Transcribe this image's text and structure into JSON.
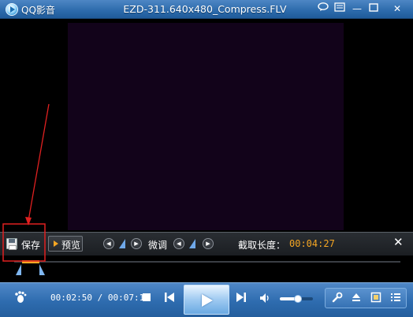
{
  "titlebar": {
    "app_name": "QQ影音",
    "title": "EZD-311.640x480_Compress.FLV",
    "chat_icon": "chat-bubble-icon",
    "menu_icon": "menu-icon",
    "minimize_glyph": "—",
    "close_glyph": "✕"
  },
  "capture": {
    "save_label": "保存",
    "preview_label": "预览",
    "fine_tune_label": "微调",
    "length_label": "截取长度：",
    "length_value": "00:04:27",
    "close_glyph": "✕",
    "nav_left_glyph": "◀",
    "nav_right_glyph": "▶"
  },
  "player": {
    "current_time": "00:02:50",
    "total_time": "00:07:18",
    "time_separator": " / ",
    "volume_fraction": 0.55,
    "prev_glyph": "⏮",
    "next_glyph": "⏭",
    "volume_glyph": "🔊",
    "tools": {
      "settings_glyph": "🔧",
      "eject_glyph": "⏏",
      "screen_glyph": "▣",
      "playlist_glyph": "☰"
    }
  },
  "colors": {
    "accent_orange": "#f5a623",
    "annotation_red": "#e02020",
    "titlebar_blue": "#2c6aab",
    "video_bg": "#12031a"
  }
}
